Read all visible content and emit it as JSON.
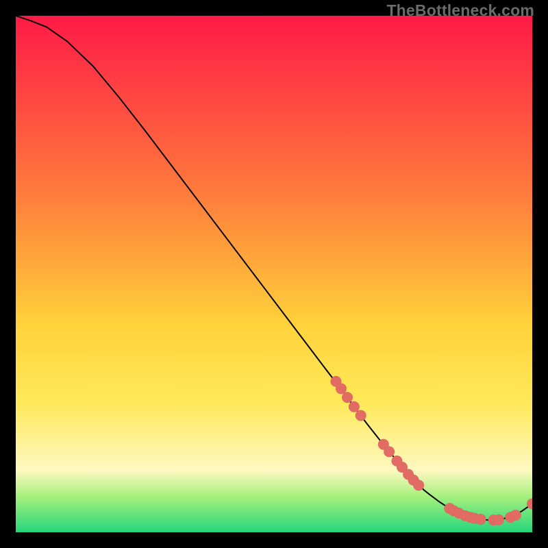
{
  "watermark": "TheBottleneck.com",
  "colors": {
    "top": "#ff1a47",
    "mid_upper": "#ff7a3c",
    "mid": "#ffd23a",
    "mid_lower": "#ffe95a",
    "pale_yellow": "#fdf8c0",
    "green_top": "#a7f07d",
    "green_bottom": "#25d67a",
    "line": "#000000",
    "dot_fill": "#e26b63",
    "dot_stroke": "#b34b45"
  },
  "chart_data": {
    "type": "line",
    "title": "",
    "xlabel": "",
    "ylabel": "",
    "xlim": [
      0,
      100
    ],
    "ylim": [
      0,
      100
    ],
    "series": [
      {
        "name": "curve",
        "x": [
          0,
          3,
          6,
          10,
          15,
          20,
          25,
          30,
          35,
          40,
          45,
          50,
          55,
          60,
          62,
          65,
          68,
          71,
          74,
          77,
          79,
          80,
          82,
          84,
          86,
          88,
          90,
          92,
          94,
          96,
          98,
          100
        ],
        "y": [
          100,
          99,
          97.8,
          95,
          90.2,
          84.2,
          77.8,
          71.2,
          64.6,
          58,
          51.4,
          44.8,
          38.2,
          31.6,
          29,
          25,
          21,
          17.2,
          13.6,
          10.2,
          8.2,
          7.4,
          5.9,
          4.6,
          3.6,
          2.9,
          2.5,
          2.3,
          2.5,
          3.1,
          4.1,
          5.5
        ]
      }
    ],
    "dots": {
      "name": "highlighted-points",
      "points": [
        {
          "x": 62,
          "y": 29.2
        },
        {
          "x": 63,
          "y": 27.8
        },
        {
          "x": 64.2,
          "y": 26.1
        },
        {
          "x": 65.5,
          "y": 24.3
        },
        {
          "x": 66.8,
          "y": 22.6
        },
        {
          "x": 71.2,
          "y": 17
        },
        {
          "x": 72.3,
          "y": 15.6
        },
        {
          "x": 73.8,
          "y": 13.8
        },
        {
          "x": 74.8,
          "y": 12.6
        },
        {
          "x": 76,
          "y": 11.2
        },
        {
          "x": 77,
          "y": 10.1
        },
        {
          "x": 78,
          "y": 9.1
        },
        {
          "x": 84,
          "y": 4.6
        },
        {
          "x": 84.8,
          "y": 4.15
        },
        {
          "x": 85.8,
          "y": 3.7
        },
        {
          "x": 87,
          "y": 3.2
        },
        {
          "x": 88,
          "y": 2.9
        },
        {
          "x": 88.8,
          "y": 2.7
        },
        {
          "x": 90,
          "y": 2.5
        },
        {
          "x": 92.5,
          "y": 2.35
        },
        {
          "x": 93.5,
          "y": 2.4
        },
        {
          "x": 95.8,
          "y": 2.9
        },
        {
          "x": 96.8,
          "y": 3.3
        },
        {
          "x": 100,
          "y": 5.5
        }
      ]
    },
    "gradient_stops": [
      {
        "offset": 0.0,
        "key": "top"
      },
      {
        "offset": 0.34,
        "key": "mid_upper"
      },
      {
        "offset": 0.6,
        "key": "mid"
      },
      {
        "offset": 0.75,
        "key": "mid_lower"
      },
      {
        "offset": 0.88,
        "key": "pale_yellow"
      },
      {
        "offset": 0.93,
        "key": "green_top"
      },
      {
        "offset": 1.0,
        "key": "green_bottom"
      }
    ]
  }
}
